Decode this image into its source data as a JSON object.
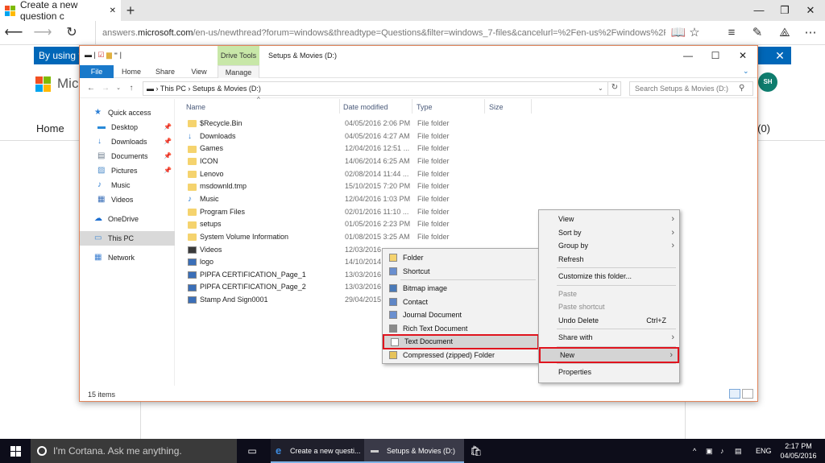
{
  "browser": {
    "tab_title": "Create a new question c",
    "new_tab": "+",
    "url_prefix": "answers.",
    "url_domain": "microsoft.com",
    "url_rest": "/en-us/newthread?forum=windows&threadtype=Questions&filter=windows_7-files&cancelurl=%2Fen-us%2Fwindows%2Fforum%2Fwind",
    "window_controls": [
      "—",
      "❐",
      "✕"
    ]
  },
  "page": {
    "cookie_text": "By using t",
    "brand_text": "Micr",
    "home_link": "Home",
    "cart_text": "s (0)",
    "avatar_initials": "SH"
  },
  "explorer": {
    "drive_tools": "Drive Tools",
    "title": "Setups & Movies (D:)",
    "ribbon_tabs": [
      "File",
      "Home",
      "Share",
      "View",
      "Manage"
    ],
    "breadcrumb": [
      "This PC",
      "Setups & Movies (D:)"
    ],
    "search_placeholder": "Search Setups & Movies (D:)",
    "nav": [
      {
        "label": "Quick access",
        "icon": "star-icon",
        "pinned": false
      },
      {
        "label": "Desktop",
        "icon": "desktop-icon",
        "pinned": true
      },
      {
        "label": "Downloads",
        "icon": "download-icon",
        "pinned": true
      },
      {
        "label": "Documents",
        "icon": "documents-icon",
        "pinned": true
      },
      {
        "label": "Pictures",
        "icon": "pictures-icon",
        "pinned": true
      },
      {
        "label": "Music",
        "icon": "music-icon",
        "pinned": false
      },
      {
        "label": "Videos",
        "icon": "videos-icon",
        "pinned": false
      },
      {
        "label": "OneDrive",
        "icon": "cloud-icon",
        "pinned": false
      },
      {
        "label": "This PC",
        "icon": "computer-icon",
        "pinned": false
      },
      {
        "label": "Network",
        "icon": "network-icon",
        "pinned": false
      }
    ],
    "columns": [
      "Name",
      "Date modified",
      "Type",
      "Size"
    ],
    "files": [
      {
        "name": "$Recycle.Bin",
        "date": "04/05/2016 2:06 PM",
        "type": "File folder",
        "icon": "folder"
      },
      {
        "name": "Downloads",
        "date": "04/05/2016 4:27 AM",
        "type": "File folder",
        "icon": "download"
      },
      {
        "name": "Games",
        "date": "12/04/2016 12:51 ...",
        "type": "File folder",
        "icon": "folder"
      },
      {
        "name": "ICON",
        "date": "14/06/2014 6:25 AM",
        "type": "File folder",
        "icon": "folder"
      },
      {
        "name": "Lenovo",
        "date": "02/08/2014 11:44 ...",
        "type": "File folder",
        "icon": "folder"
      },
      {
        "name": "msdownld.tmp",
        "date": "15/10/2015 7:20 PM",
        "type": "File folder",
        "icon": "folder"
      },
      {
        "name": "Music",
        "date": "12/04/2016 1:03 PM",
        "type": "File folder",
        "icon": "music"
      },
      {
        "name": "Program Files",
        "date": "02/01/2016 11:10 ...",
        "type": "File folder",
        "icon": "folder"
      },
      {
        "name": "setups",
        "date": "01/05/2016 2:23 PM",
        "type": "File folder",
        "icon": "folder"
      },
      {
        "name": "System Volume Information",
        "date": "01/08/2015 3:25 AM",
        "type": "File folder",
        "icon": "folder"
      },
      {
        "name": "Videos",
        "date": "12/03/2016",
        "type": "",
        "icon": "videos"
      },
      {
        "name": "logo",
        "date": "14/10/2014",
        "type": "",
        "icon": "image"
      },
      {
        "name": "PIPFA CERTIFICATION_Page_1",
        "date": "13/03/2016",
        "type": "",
        "icon": "image"
      },
      {
        "name": "PIPFA CERTIFICATION_Page_2",
        "date": "13/03/2016",
        "type": "",
        "icon": "image"
      },
      {
        "name": "Stamp And Sign0001",
        "date": "29/04/2015",
        "type": "",
        "icon": "image"
      }
    ],
    "status": "15 items"
  },
  "context_menu": {
    "items": [
      {
        "label": "View",
        "shortcut": "",
        "submenu": true,
        "disabled": false,
        "sep_after": false
      },
      {
        "label": "Sort by",
        "shortcut": "",
        "submenu": true,
        "disabled": false,
        "sep_after": false
      },
      {
        "label": "Group by",
        "shortcut": "",
        "submenu": true,
        "disabled": false,
        "sep_after": false
      },
      {
        "label": "Refresh",
        "shortcut": "",
        "submenu": false,
        "disabled": false,
        "sep_after": true
      },
      {
        "label": "Customize this folder...",
        "shortcut": "",
        "submenu": false,
        "disabled": false,
        "sep_after": true
      },
      {
        "label": "Paste",
        "shortcut": "",
        "submenu": false,
        "disabled": true,
        "sep_after": false
      },
      {
        "label": "Paste shortcut",
        "shortcut": "",
        "submenu": false,
        "disabled": true,
        "sep_after": false
      },
      {
        "label": "Undo Delete",
        "shortcut": "Ctrl+Z",
        "submenu": false,
        "disabled": false,
        "sep_after": true
      },
      {
        "label": "Share with",
        "shortcut": "",
        "submenu": true,
        "disabled": false,
        "sep_after": true
      },
      {
        "label": "New",
        "shortcut": "",
        "submenu": true,
        "disabled": false,
        "sep_after": true
      },
      {
        "label": "Properties",
        "shortcut": "",
        "submenu": false,
        "disabled": false,
        "sep_after": false
      }
    ]
  },
  "new_submenu": {
    "items": [
      {
        "label": "Folder",
        "icon": "folder-icon",
        "sep_after": false
      },
      {
        "label": "Shortcut",
        "icon": "shortcut-icon",
        "sep_after": true
      },
      {
        "label": "Bitmap image",
        "icon": "bitmap-icon",
        "sep_after": false
      },
      {
        "label": "Contact",
        "icon": "contact-icon",
        "sep_after": false
      },
      {
        "label": "Journal Document",
        "icon": "journal-icon",
        "sep_after": false
      },
      {
        "label": "Rich Text Document",
        "icon": "rtf-icon",
        "sep_after": false
      },
      {
        "label": "Text Document",
        "icon": "text-document-icon",
        "sep_after": false
      },
      {
        "label": "Compressed (zipped) Folder",
        "icon": "zip-folder-icon",
        "sep_after": false
      }
    ]
  },
  "taskbar": {
    "cortana": "I'm Cortana. Ask me anything.",
    "apps": [
      "Create a new questi...",
      "Setups & Movies (D:)"
    ],
    "lang": "ENG",
    "time": "2:17 PM",
    "date": "04/05/2016"
  },
  "colors": {
    "accent": "#1979ca",
    "drive_tools": "#c8e7a8",
    "highlight_box": "#e0141e",
    "taskbar": "#0d0d1a"
  }
}
